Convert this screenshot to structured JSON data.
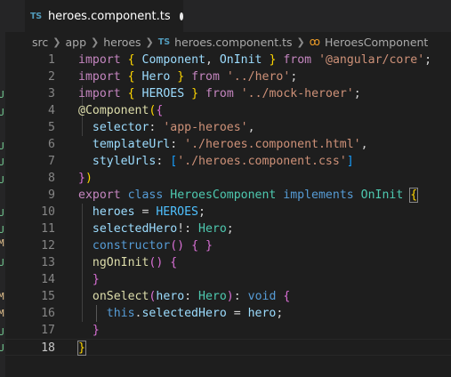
{
  "tab": {
    "badge": "TS",
    "title": "heroes.component.ts"
  },
  "breadcrumb": {
    "items": [
      "src",
      "app",
      "heroes",
      "heroes.component.ts",
      "HeroesComponent"
    ],
    "file_badge": "TS"
  },
  "scm_markers": [
    "U",
    "U",
    "U",
    "U",
    "U",
    "U",
    "U",
    "M",
    "U",
    "M",
    "M",
    "U",
    "U"
  ],
  "editor": {
    "current_line": 18,
    "lines": [
      {
        "n": "1",
        "tokens": [
          [
            "kw",
            "import"
          ],
          [
            "pl",
            " "
          ],
          [
            "br1",
            "{"
          ],
          [
            "pl",
            " "
          ],
          [
            "id",
            "Component"
          ],
          [
            "pl",
            ", "
          ],
          [
            "id",
            "OnInit"
          ],
          [
            "pl",
            " "
          ],
          [
            "br1",
            "}"
          ],
          [
            "pl",
            " "
          ],
          [
            "kw",
            "from"
          ],
          [
            "pl",
            " "
          ],
          [
            "str",
            "'@angular/core'"
          ],
          [
            "pl",
            ";"
          ]
        ]
      },
      {
        "n": "2",
        "tokens": [
          [
            "kw",
            "import"
          ],
          [
            "pl",
            " "
          ],
          [
            "br1",
            "{"
          ],
          [
            "pl",
            " "
          ],
          [
            "id",
            "Hero"
          ],
          [
            "pl",
            " "
          ],
          [
            "br1",
            "}"
          ],
          [
            "pl",
            " "
          ],
          [
            "kw",
            "from"
          ],
          [
            "pl",
            " "
          ],
          [
            "str",
            "'../hero'"
          ],
          [
            "pl",
            ";"
          ]
        ]
      },
      {
        "n": "3",
        "tokens": [
          [
            "kw",
            "import"
          ],
          [
            "pl",
            " "
          ],
          [
            "br1",
            "{"
          ],
          [
            "pl",
            " "
          ],
          [
            "id",
            "HEROES"
          ],
          [
            "pl",
            " "
          ],
          [
            "br1",
            "}"
          ],
          [
            "pl",
            " "
          ],
          [
            "kw",
            "from"
          ],
          [
            "pl",
            " "
          ],
          [
            "str",
            "'../mock-heroer'"
          ],
          [
            "pl",
            ";"
          ]
        ]
      },
      {
        "n": "4",
        "tokens": [
          [
            "fn",
            "@"
          ],
          [
            "fn",
            "Component"
          ],
          [
            "br1",
            "("
          ],
          [
            "br2",
            "{"
          ]
        ]
      },
      {
        "n": "5",
        "tokens": [
          [
            "pl",
            "  "
          ],
          [
            "id",
            "selector"
          ],
          [
            "pl",
            ": "
          ],
          [
            "str",
            "'app-heroes'"
          ],
          [
            "pl",
            ","
          ]
        ]
      },
      {
        "n": "6",
        "tokens": [
          [
            "pl",
            "  "
          ],
          [
            "id",
            "templateUrl"
          ],
          [
            "pl",
            ": "
          ],
          [
            "str",
            "'./heroes.component.html'"
          ],
          [
            "pl",
            ","
          ]
        ]
      },
      {
        "n": "7",
        "tokens": [
          [
            "pl",
            "  "
          ],
          [
            "id",
            "styleUrls"
          ],
          [
            "pl",
            ": "
          ],
          [
            "br3",
            "["
          ],
          [
            "str",
            "'./heroes.component.css'"
          ],
          [
            "br3",
            "]"
          ]
        ]
      },
      {
        "n": "8",
        "tokens": [
          [
            "br2",
            "}"
          ],
          [
            "br1",
            ")"
          ]
        ]
      },
      {
        "n": "9",
        "tokens": [
          [
            "kw",
            "export"
          ],
          [
            "pl",
            " "
          ],
          [
            "kw2",
            "class"
          ],
          [
            "pl",
            " "
          ],
          [
            "cls",
            "HeroesComponent"
          ],
          [
            "pl",
            " "
          ],
          [
            "kw2",
            "implements"
          ],
          [
            "pl",
            " "
          ],
          [
            "cls",
            "OnInit"
          ],
          [
            "pl",
            " "
          ],
          [
            "br1",
            "{"
          ]
        ]
      },
      {
        "n": "10",
        "tokens": [
          [
            "pl",
            "  "
          ],
          [
            "mbr",
            "heroes"
          ],
          [
            "pl",
            " = "
          ],
          [
            "cst",
            "HEROES"
          ],
          [
            "pl",
            ";"
          ]
        ]
      },
      {
        "n": "11",
        "tokens": [
          [
            "pl",
            "  "
          ],
          [
            "mbr",
            "selectedHero"
          ],
          [
            "pl",
            "!: "
          ],
          [
            "cls",
            "Hero"
          ],
          [
            "pl",
            ";"
          ]
        ]
      },
      {
        "n": "12",
        "tokens": [
          [
            "pl",
            "  "
          ],
          [
            "kw2",
            "constructor"
          ],
          [
            "br2",
            "()"
          ],
          [
            "pl",
            " "
          ],
          [
            "br2",
            "{"
          ],
          [
            "pl",
            " "
          ],
          [
            "br2",
            "}"
          ]
        ]
      },
      {
        "n": "13",
        "tokens": [
          [
            "pl",
            "  "
          ],
          [
            "fn",
            "ngOnInit"
          ],
          [
            "br2",
            "()"
          ],
          [
            "pl",
            " "
          ],
          [
            "br2",
            "{"
          ]
        ]
      },
      {
        "n": "14",
        "tokens": [
          [
            "pl",
            "  "
          ],
          [
            "br2",
            "}"
          ]
        ]
      },
      {
        "n": "15",
        "tokens": [
          [
            "pl",
            "  "
          ],
          [
            "fn",
            "onSelect"
          ],
          [
            "br2",
            "("
          ],
          [
            "id",
            "hero"
          ],
          [
            "pl",
            ": "
          ],
          [
            "cls",
            "Hero"
          ],
          [
            "br2",
            ")"
          ],
          [
            "pl",
            ": "
          ],
          [
            "kw2",
            "void"
          ],
          [
            "pl",
            " "
          ],
          [
            "br2",
            "{"
          ]
        ]
      },
      {
        "n": "16",
        "tokens": [
          [
            "pl",
            "    "
          ],
          [
            "kw2",
            "this"
          ],
          [
            "pl",
            "."
          ],
          [
            "mbr",
            "selectedHero"
          ],
          [
            "pl",
            " = "
          ],
          [
            "id",
            "hero"
          ],
          [
            "pl",
            ";"
          ]
        ]
      },
      {
        "n": "17",
        "tokens": [
          [
            "pl",
            "  "
          ],
          [
            "br2",
            "}"
          ]
        ]
      },
      {
        "n": "18",
        "tokens": [
          [
            "br1",
            "}"
          ]
        ]
      }
    ]
  }
}
